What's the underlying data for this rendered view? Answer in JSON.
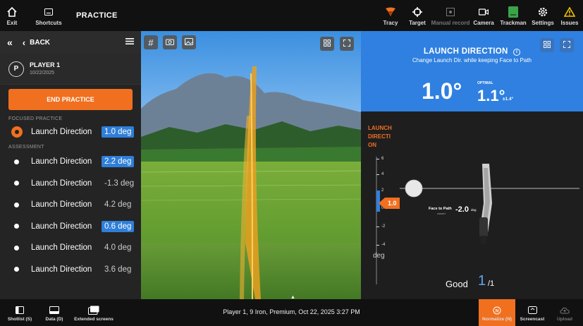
{
  "topbar": {
    "exit_label": "Exit",
    "shortcuts_label": "Shortcuts",
    "title": "PRACTICE",
    "tracy_label": "Tracy",
    "target_label": "Target",
    "manual_record_label": "Manual record",
    "camera_label": "Camera",
    "trackman_label": "Trackman",
    "settings_label": "Settings",
    "issues_label": "Issues"
  },
  "sidebar": {
    "back_label": "BACK",
    "player": {
      "initial": "P",
      "name": "PLAYER 1",
      "date": "10/22/2025"
    },
    "end_practice_label": "END PRACTICE",
    "focused_label": "FOCUSED PRACTICE",
    "focused": {
      "label": "Launch Direction",
      "value": "1.0 deg"
    },
    "assessment_label": "ASSESSMENT",
    "assessment": [
      {
        "label": "Launch Direction",
        "value": "2.2 deg",
        "highlight": true
      },
      {
        "label": "Launch Direction",
        "value": "-1.3 deg",
        "highlight": false
      },
      {
        "label": "Launch Direction",
        "value": "4.2 deg",
        "highlight": false
      },
      {
        "label": "Launch Direction",
        "value": "0.6 deg",
        "highlight": true
      },
      {
        "label": "Launch Direction",
        "value": "4.0 deg",
        "highlight": false
      },
      {
        "label": "Launch Direction",
        "value": "3.6 deg",
        "highlight": false
      }
    ]
  },
  "panel": {
    "title": "LAUNCH DIRECTION",
    "subtitle": "Change Launch Dir. while keeping Face to Path",
    "value": "1.0°",
    "optimal_label": "OPTIMAL",
    "optimal_value": "1.1°",
    "optimal_tolerance": "±1.4°",
    "scale_title": "LAUNCH DIRECTI ON",
    "scale_ticks": [
      "6",
      "4",
      "2",
      "0",
      "-2",
      "-4"
    ],
    "scale_unit": "deg",
    "marker_value": "1.0",
    "face_to_path_label": "Face to Path",
    "face_to_path_sub": "closed",
    "face_to_path_value": "-2.0",
    "face_to_path_unit": "deg",
    "good_label": "Good",
    "good_count": "1",
    "good_total": "/1"
  },
  "bottombar": {
    "shotlist_label": "Shotlist (S)",
    "data_label": "Data (D)",
    "extended_label": "Extended screens",
    "status": "Player 1, 9 Iron, Premium, Oct 22, 2025 3:27 PM",
    "normalize_label": "Normalize (N)",
    "screencast_label": "Screencast",
    "upload_label": "Upload"
  },
  "colors": {
    "accent": "#f07020",
    "highlight": "#2f7fd9",
    "panel_blue": "#2f80e0",
    "good": "#5aa7f0"
  }
}
